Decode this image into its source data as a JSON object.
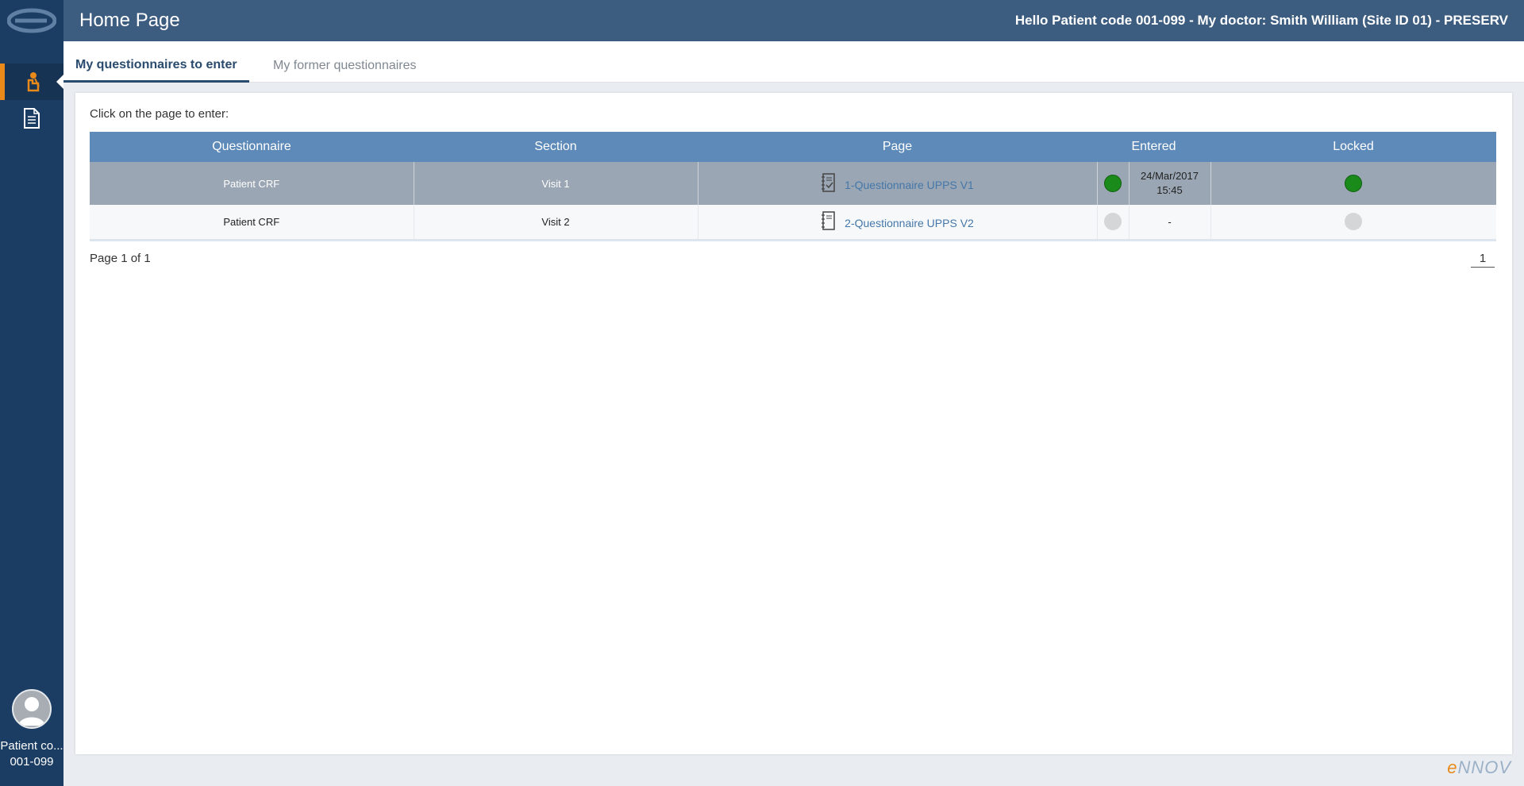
{
  "header": {
    "title": "Home Page",
    "greeting": "Hello Patient code 001-099 - My doctor: Smith William (Site ID 01) - PRESERV"
  },
  "tabs": [
    {
      "label": "My questionnaires to enter"
    },
    {
      "label": "My former questionnaires"
    }
  ],
  "instruction": "Click on the page to enter:",
  "table": {
    "columns": [
      "Questionnaire",
      "Section",
      "Page",
      "Entered",
      "Locked"
    ],
    "rows": [
      {
        "questionnaire": "Patient CRF",
        "section": "Visit 1",
        "page": "1-Questionnaire UPPS V1",
        "entered_status": "green",
        "entered_date": "24/Mar/2017",
        "entered_time": "15:45",
        "locked_status": "green"
      },
      {
        "questionnaire": "Patient CRF",
        "section": "Visit 2",
        "page": "2-Questionnaire UPPS V2",
        "entered_status": "grey",
        "entered_date": "-",
        "entered_time": "",
        "locked_status": "grey"
      }
    ]
  },
  "pager": {
    "info": "Page 1 of 1",
    "current": "1"
  },
  "user": {
    "line1": "Patient co...",
    "line2": "001-099"
  },
  "brand": {
    "e": "e",
    "rest": "NNOV"
  },
  "colors": {
    "sidebar": "#1b3d63",
    "header": "#3d5d80",
    "accent": "#e8891a",
    "table_header": "#5d8ab9",
    "link": "#4477aa"
  },
  "icons": [
    "logo-icon",
    "patient-icon",
    "document-icon",
    "avatar-icon",
    "page-checked-icon",
    "page-icon"
  ]
}
